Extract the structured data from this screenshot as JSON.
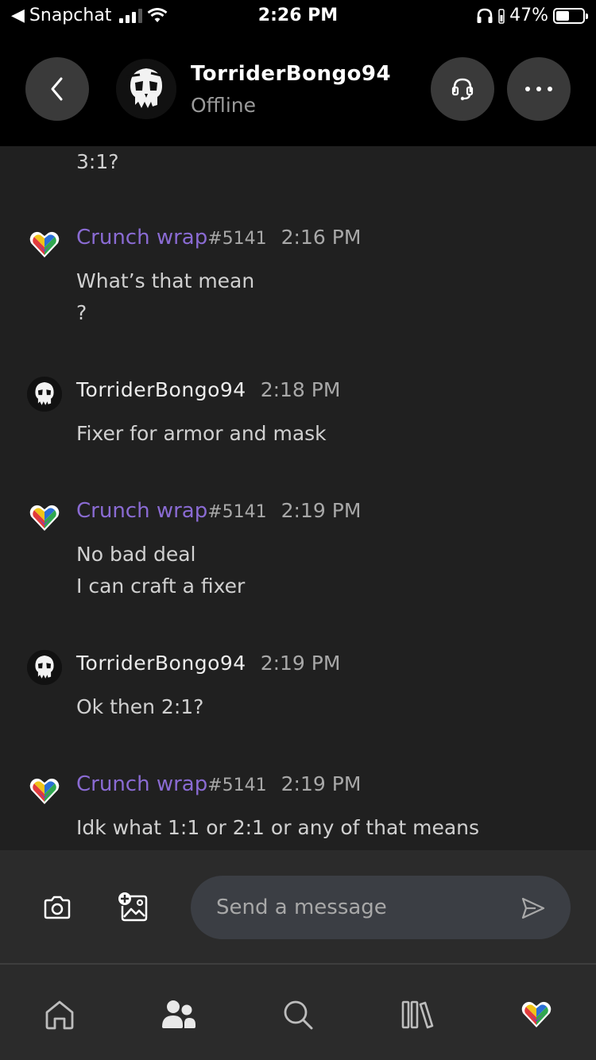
{
  "status_bar": {
    "back_app": "Snapchat",
    "time": "2:26 PM",
    "battery": "47%"
  },
  "header": {
    "contact_name": "TorriderBongo94",
    "contact_status": "Offline"
  },
  "chat": {
    "partial_top_text": "3:1?",
    "messages": [
      {
        "author": "Crunch wrap",
        "tag": "#5141",
        "time": "2:16 PM",
        "lines": [
          "What’s that mean",
          "?"
        ]
      },
      {
        "author": "TorriderBongo94",
        "tag": "",
        "time": "2:18 PM",
        "lines": [
          "Fixer for armor and mask"
        ]
      },
      {
        "author": "Crunch wrap",
        "tag": "#5141",
        "time": "2:19 PM",
        "lines": [
          "No bad deal",
          "I can craft a fixer"
        ]
      },
      {
        "author": "TorriderBongo94",
        "tag": "",
        "time": "2:19 PM",
        "lines": [
          "Ok then 2:1?"
        ]
      },
      {
        "author": "Crunch wrap",
        "tag": "#5141",
        "time": "2:19 PM",
        "lines": [
          "Idk what 1:1 or 2:1 or any of that means"
        ]
      }
    ]
  },
  "composer": {
    "placeholder": "Send a message"
  },
  "nav": {
    "items": [
      "home-icon",
      "friends-icon",
      "search-icon",
      "library-icon",
      "profile-icon"
    ]
  },
  "colors": {
    "accent_purple": "#8a6bd3",
    "background": "#202020",
    "header_bg": "#000000"
  }
}
